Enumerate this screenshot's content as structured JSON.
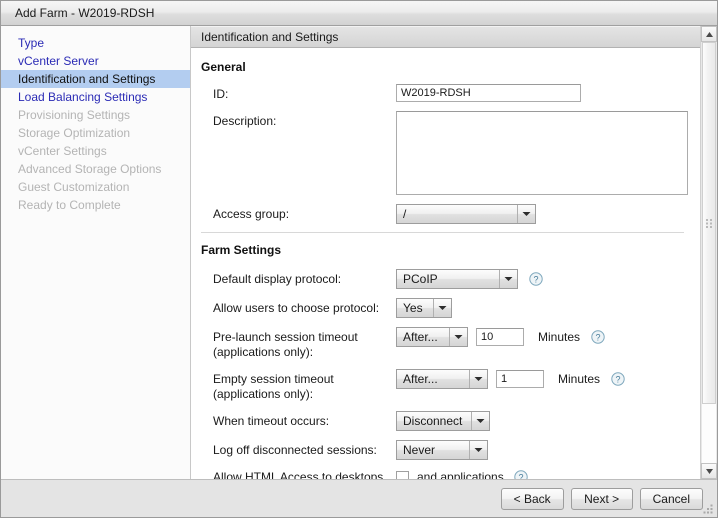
{
  "window": {
    "title": "Add Farm - W2019-RDSH"
  },
  "sidebar": {
    "items": [
      {
        "label": "Type",
        "state": "done"
      },
      {
        "label": "vCenter Server",
        "state": "done"
      },
      {
        "label": "Identification and Settings",
        "state": "active"
      },
      {
        "label": "Load Balancing Settings",
        "state": "done"
      },
      {
        "label": "Provisioning Settings",
        "state": "disabled"
      },
      {
        "label": "Storage Optimization",
        "state": "disabled"
      },
      {
        "label": "vCenter Settings",
        "state": "disabled"
      },
      {
        "label": "Advanced Storage Options",
        "state": "disabled"
      },
      {
        "label": "Guest Customization",
        "state": "disabled"
      },
      {
        "label": "Ready to Complete",
        "state": "disabled"
      }
    ]
  },
  "content": {
    "header": "Identification and Settings",
    "general": {
      "title": "General",
      "id_label": "ID:",
      "id_value": "W2019-RDSH",
      "description_label": "Description:",
      "description_value": "",
      "access_group_label": "Access group:",
      "access_group_value": "/"
    },
    "farm_settings": {
      "title": "Farm Settings",
      "default_protocol_label": "Default display protocol:",
      "default_protocol_value": "PCoIP",
      "allow_choose_label": "Allow users to choose protocol:",
      "allow_choose_value": "Yes",
      "prelaunch_label": "Pre-launch session timeout (applications only):",
      "prelaunch_mode": "After...",
      "prelaunch_value": "10",
      "prelaunch_unit": "Minutes",
      "empty_label": "Empty session timeout (applications only):",
      "empty_mode": "After...",
      "empty_value": "1",
      "empty_unit": "Minutes",
      "when_timeout_label": "When timeout occurs:",
      "when_timeout_value": "Disconnect",
      "logoff_label": "Log off disconnected sessions:",
      "logoff_value": "Never",
      "html_access_label": "Allow HTML Access to desktops",
      "html_access_suffix": "and applications"
    }
  },
  "footer": {
    "back": "< Back",
    "next": "Next >",
    "cancel": "Cancel"
  }
}
